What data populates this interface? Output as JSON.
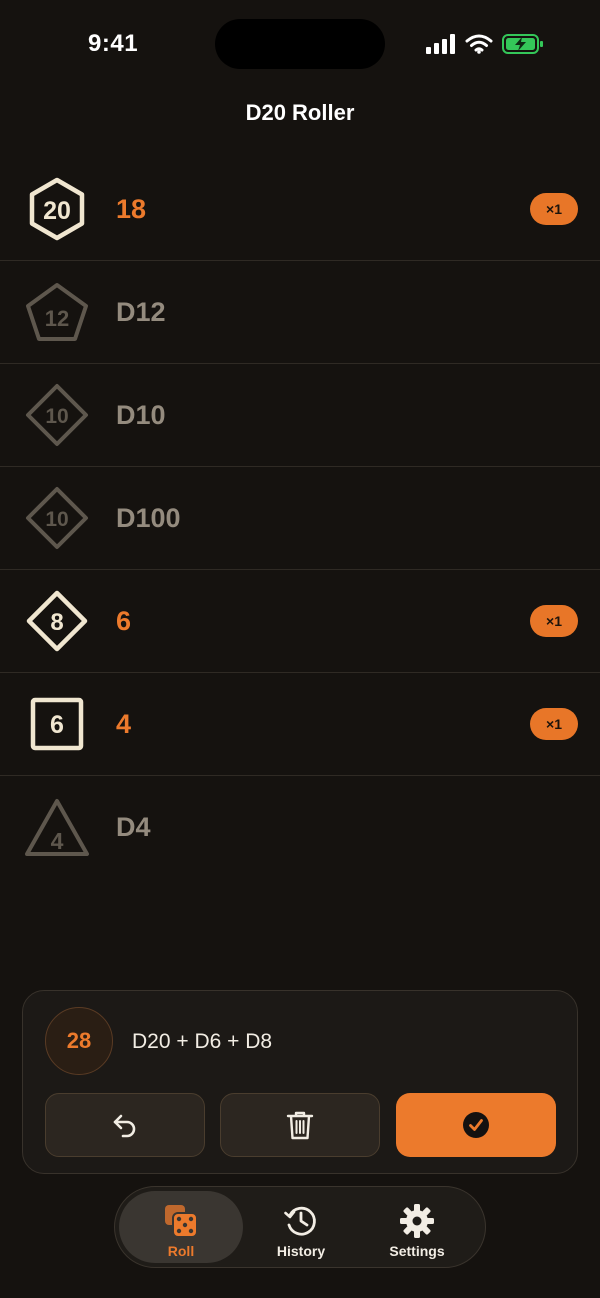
{
  "status_bar": {
    "time": "9:41"
  },
  "header": {
    "title": "D20 Roller"
  },
  "dice": [
    {
      "die": "D20",
      "icon_number": "20",
      "shape": "hexagon",
      "label": "18",
      "active": true,
      "count": "×1"
    },
    {
      "die": "D12",
      "icon_number": "12",
      "shape": "pentagon",
      "label": "D12",
      "active": false,
      "count": ""
    },
    {
      "die": "D10",
      "icon_number": "10",
      "shape": "diamond",
      "label": "D10",
      "active": false,
      "count": ""
    },
    {
      "die": "D100",
      "icon_number": "10",
      "shape": "diamond",
      "label": "D100",
      "active": false,
      "count": ""
    },
    {
      "die": "D8",
      "icon_number": "8",
      "shape": "diamond",
      "label": "6",
      "active": true,
      "count": "×1"
    },
    {
      "die": "D6",
      "icon_number": "6",
      "shape": "square",
      "label": "4",
      "active": true,
      "count": "×1"
    },
    {
      "die": "D4",
      "icon_number": "4",
      "shape": "triangle",
      "label": "D4",
      "active": false,
      "count": ""
    }
  ],
  "result_panel": {
    "total": "28",
    "formula": "D20 + D6 + D8",
    "buttons": {
      "undo_icon": "undo-arrow-icon",
      "clear_icon": "trash-icon",
      "confirm_icon": "checkmark-circle-icon"
    }
  },
  "tabs": [
    {
      "label": "Roll",
      "icon": "dice-icon",
      "selected": true
    },
    {
      "label": "History",
      "icon": "history-clock-icon",
      "selected": false
    },
    {
      "label": "Settings",
      "icon": "gear-icon",
      "selected": false
    }
  ],
  "colors": {
    "background": "#15120f",
    "accent": "#ec7a2c",
    "active_icon": "#f0e6d0",
    "idle_icon": "#5e574d",
    "idle_text": "#948b7e",
    "battery": "#34c759"
  }
}
